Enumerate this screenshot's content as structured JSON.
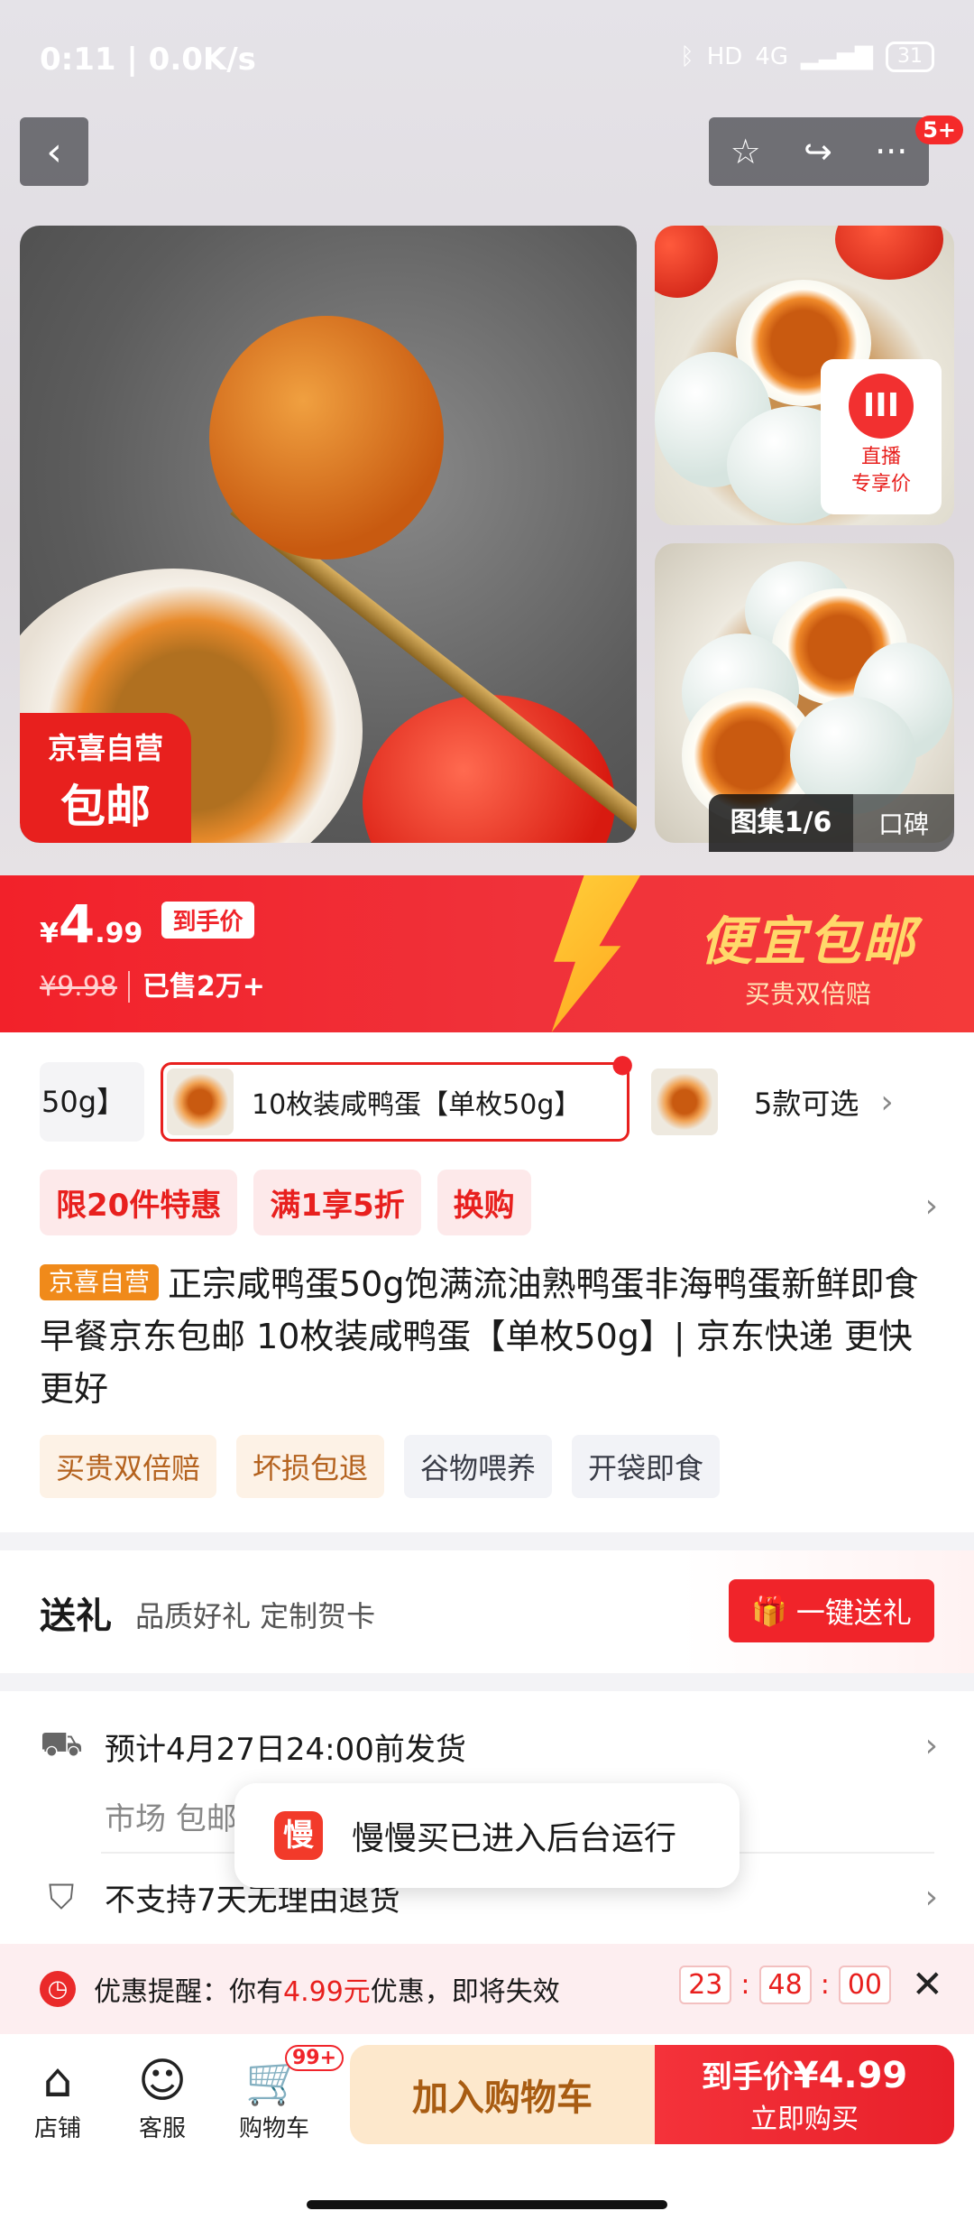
{
  "status_bar": {
    "time": "0:11",
    "speed": "0.0K/s",
    "network": "4G",
    "hd": "HD",
    "battery": "31"
  },
  "nav": {
    "back_icon": "‹",
    "fav_icon": "☆",
    "share_icon": "↪",
    "more_icon": "···",
    "badge": "5+"
  },
  "images": {
    "main_stamp_line1": "京喜自营",
    "main_stamp_line2": "包邮",
    "live_icon": "III",
    "live_line1": "直播",
    "live_line2": "专享价",
    "gallery": "图集1/6",
    "reviews": "口碑"
  },
  "price": {
    "currency": "¥",
    "int": "4",
    "dec": ".99",
    "to_hand_label": "到手价",
    "old": "¥9.98",
    "sold": "已售2万+",
    "promo_title": "便宜包邮",
    "promo_sub": "买贵双倍赔"
  },
  "sku": {
    "prev": "50g】",
    "selected": "10枚装咸鸭蛋【单枚50g】",
    "more": "5款可选",
    "chevron": "›"
  },
  "promo_tags": [
    "限20件特惠",
    "满1享5折",
    "换购"
  ],
  "product": {
    "store_tag": "京喜自营",
    "title": "正宗咸鸭蛋50g饱满流油熟鸭蛋非海鸭蛋新鲜即食早餐京东包邮 10枚装咸鸭蛋【单枚50g】| 京东快递 更快更好"
  },
  "feature_tags": {
    "orange": [
      "买贵双倍赔",
      "坏损包退"
    ],
    "gray": [
      "谷物喂养",
      "开袋即食"
    ]
  },
  "gift": {
    "title": "送礼",
    "subtitle": "品质好礼 定制贺卡",
    "button_icon": "🎁",
    "button": "一键送礼"
  },
  "shipping": {
    "truck_icon": "⛟",
    "line": "预计4月27日24:00前发货",
    "sub": "市场  包邮",
    "shield_icon": "⛉",
    "return_policy": "不支持7天无理由退货"
  },
  "toast": {
    "icon": "慢",
    "text": "慢慢买已进入后台运行"
  },
  "reminder": {
    "clock_icon": "◷",
    "prefix": "优惠提醒：你有",
    "amount": "4.99元",
    "suffix": "优惠，即将失效",
    "hh": "23",
    "mm": "48",
    "ss": "00",
    "close": "✕"
  },
  "bottom_bar": {
    "store": "店铺",
    "store_icon": "⌂",
    "service": "客服",
    "service_icon": "☺",
    "cart": "购物车",
    "cart_icon": "🛒",
    "cart_badge": "99+",
    "add_cart": "加入购物车",
    "buy_line1_label": "到手价",
    "buy_line1_price": "¥4.99",
    "buy_line2": "立即购买"
  }
}
